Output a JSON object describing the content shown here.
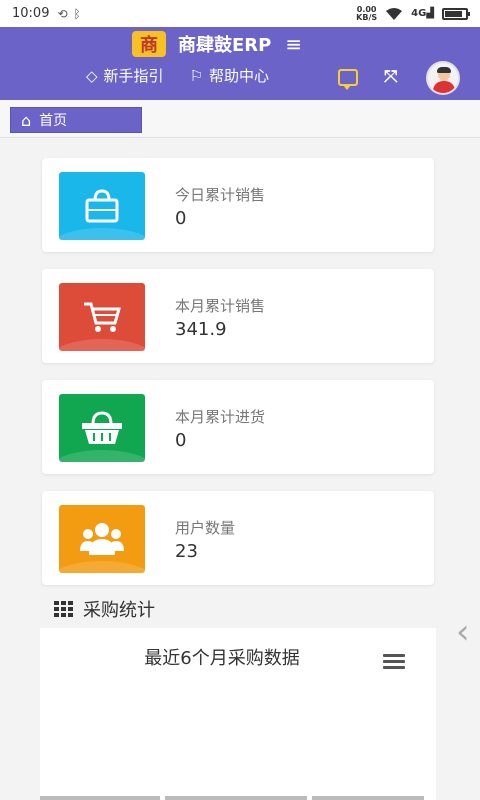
{
  "statusbar": {
    "time": "10:09",
    "speed_value": "0.00",
    "speed_unit": "KB/S",
    "signal": "4G",
    "battery_level": 0.85
  },
  "header": {
    "logo_char": "商",
    "app_name": "商肆鼓ERP",
    "menu_icon": "hamburger-icon",
    "guide_label": "新手指引",
    "help_label": "帮助中心"
  },
  "tabs": {
    "home_label": "首页"
  },
  "cards": [
    {
      "label": "今日累计销售",
      "value": "0",
      "color": "#1ab7ea",
      "icon": "shopping-bag-icon"
    },
    {
      "label": "本月累计销售",
      "value": "341.9",
      "color": "#dd4b39",
      "icon": "cart-icon"
    },
    {
      "label": "本月累计进货",
      "value": "0",
      "color": "#11a750",
      "icon": "basket-icon"
    },
    {
      "label": "用户数量",
      "value": "23",
      "color": "#f39c12",
      "icon": "users-icon"
    }
  ],
  "section": {
    "title": "采购统计"
  },
  "chart": {
    "title": "最近6个月采购数据",
    "menu_icon": "chart-menu-icon"
  }
}
